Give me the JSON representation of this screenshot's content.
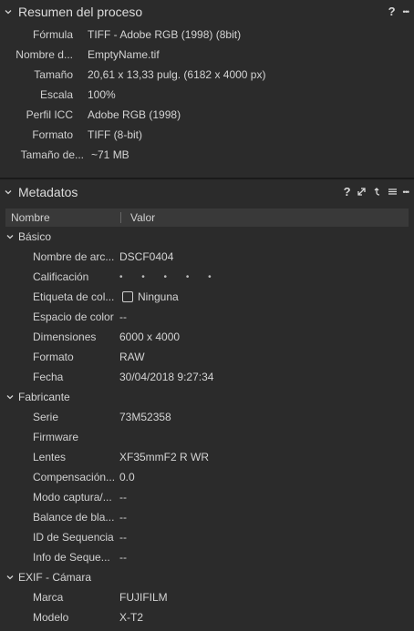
{
  "process_summary": {
    "title": "Resumen del proceso",
    "help": "?",
    "more": "•••",
    "rows": [
      {
        "label": "Fórmula",
        "value": "TIFF - Adobe RGB (1998) (8bit)"
      },
      {
        "label": "Nombre d...",
        "value": "EmptyName.tif"
      },
      {
        "label": "Tamaño",
        "value": "20,61 x 13,33 pulg. (6182 x 4000 px)"
      },
      {
        "label": "Escala",
        "value": "100%"
      },
      {
        "label": "Perfil ICC",
        "value": "Adobe RGB (1998)"
      },
      {
        "label": "Formato",
        "value": "TIFF (8-bit)"
      },
      {
        "label": "Tamaño de...",
        "value": "~71 MB"
      }
    ]
  },
  "metadata": {
    "title": "Metadatos",
    "help": "?",
    "more": "•••",
    "columns": {
      "name": "Nombre",
      "value": "Valor"
    },
    "groups": [
      {
        "name": "Básico",
        "rows": [
          {
            "label": "Nombre de arc...",
            "value": "DSCF0404"
          },
          {
            "label": "Calificación",
            "value": "• • • • •"
          },
          {
            "label": "Etiqueta de col...",
            "value": "Ninguna"
          },
          {
            "label": "Espacio de color",
            "value": "--"
          },
          {
            "label": "Dimensiones",
            "value": "6000 x 4000"
          },
          {
            "label": "Formato",
            "value": "RAW"
          },
          {
            "label": "Fecha",
            "value": "30/04/2018 9:27:34"
          }
        ]
      },
      {
        "name": "Fabricante",
        "rows": [
          {
            "label": "Serie",
            "value": "73M52358"
          },
          {
            "label": "Firmware",
            "value": ""
          },
          {
            "label": "Lentes",
            "value": "XF35mmF2 R WR"
          },
          {
            "label": "Compensación...",
            "value": "0.0"
          },
          {
            "label": "Modo captura/...",
            "value": "--"
          },
          {
            "label": "Balance de bla...",
            "value": "--"
          },
          {
            "label": "ID de Sequencia",
            "value": "--"
          },
          {
            "label": "Info de Seque...",
            "value": "--"
          }
        ]
      },
      {
        "name": "EXIF - Cámara",
        "rows": [
          {
            "label": "Marca",
            "value": "FUJIFILM"
          },
          {
            "label": "Modelo",
            "value": "X-T2"
          }
        ]
      }
    ]
  }
}
